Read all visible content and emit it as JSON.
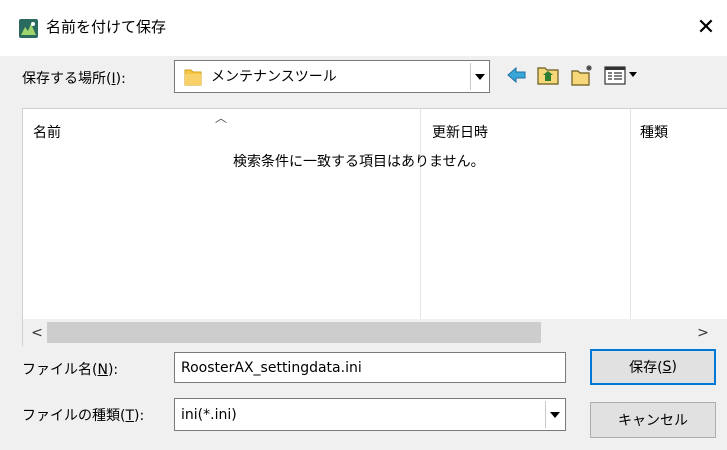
{
  "window": {
    "title": "名前を付けて保存",
    "close_glyph": "✕"
  },
  "location": {
    "label_prefix": "保存する場所(",
    "label_key": "I",
    "label_suffix": "):",
    "value": "メンテナンスツール"
  },
  "toolbar": {
    "icons": [
      "back-arrow-icon",
      "up-folder-icon",
      "new-folder-icon",
      "view-menu-icon"
    ]
  },
  "file_list": {
    "columns": [
      "名前",
      "更新日時",
      "種類"
    ],
    "empty_message": "検索条件に一致する項目はありません。"
  },
  "scrollbar": {
    "left": "<",
    "right": ">"
  },
  "filename": {
    "label_prefix": "ファイル名(",
    "label_key": "N",
    "label_suffix": "):",
    "value": "RoosterAX_settingdata.ini"
  },
  "filetype": {
    "label_prefix": "ファイルの種類(",
    "label_key": "T",
    "label_suffix": "):",
    "value": "ini(*.ini)"
  },
  "buttons": {
    "save_prefix": "保存(",
    "save_key": "S",
    "save_suffix": ")",
    "cancel": "キャンセル"
  },
  "colors": {
    "accent": "#0078d7",
    "folder": "#f6c744"
  }
}
